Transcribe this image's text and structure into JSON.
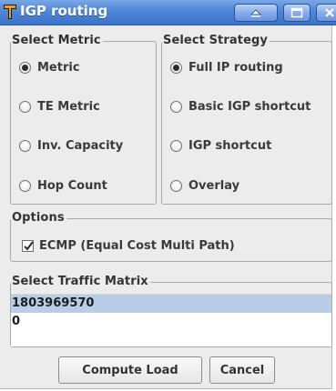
{
  "window": {
    "title": "IGP routing",
    "app_icon": "tool-t-icon",
    "controls": [
      "shade-icon",
      "maximize-icon",
      "close-icon"
    ]
  },
  "metric": {
    "title": "Select Metric",
    "options": [
      {
        "label": "Metric",
        "selected": true
      },
      {
        "label": "TE Metric",
        "selected": false
      },
      {
        "label": "Inv. Capacity",
        "selected": false
      },
      {
        "label": "Hop Count",
        "selected": false
      }
    ]
  },
  "strategy": {
    "title": "Select Strategy",
    "options": [
      {
        "label": "Full IP routing",
        "selected": true
      },
      {
        "label": "Basic IGP shortcut",
        "selected": false
      },
      {
        "label": "IGP shortcut",
        "selected": false
      },
      {
        "label": "Overlay",
        "selected": false
      }
    ]
  },
  "options": {
    "title": "Options",
    "ecmp": {
      "label": "ECMP (Equal Cost Multi Path)",
      "checked": true
    }
  },
  "matrix": {
    "title": "Select Traffic Matrix",
    "items": [
      "1803969570",
      "0"
    ],
    "selected_index": 0
  },
  "buttons": {
    "compute": "Compute Load",
    "cancel": "Cancel"
  },
  "colors": {
    "titlebar": "#4f86d6",
    "selection": "#b8cde6",
    "panel": "#ececec"
  }
}
